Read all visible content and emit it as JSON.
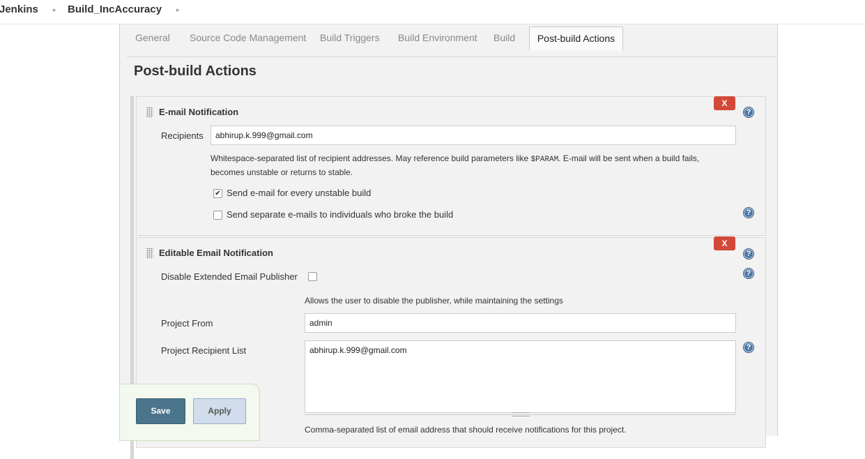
{
  "breadcrumb": {
    "items": [
      "Jenkins",
      "Build_IncAccuracy"
    ],
    "separator": "▸"
  },
  "tabs": [
    {
      "label": "General",
      "active": false
    },
    {
      "label": "Source Code Management",
      "active": false
    },
    {
      "label": "Build Triggers",
      "active": false
    },
    {
      "label": "Build Environment",
      "active": false
    },
    {
      "label": "Build",
      "active": false
    },
    {
      "label": "Post-build Actions",
      "active": true
    }
  ],
  "section_title": "Post-build Actions",
  "email_notification": {
    "title": "E-mail Notification",
    "delete_label": "X",
    "recipients_label": "Recipients",
    "recipients_value": "abhirup.k.999@gmail.com",
    "description_part1": "Whitespace-separated list of recipient addresses. May reference build parameters like ",
    "description_code": "$PARAM",
    "description_part2": ". E-mail will be sent when a build fails, becomes unstable or returns to stable.",
    "checkbox_unstable_label": "Send e-mail for every unstable build",
    "checkbox_unstable_checked": true,
    "checkbox_individuals_label": "Send separate e-mails to individuals who broke the build",
    "checkbox_individuals_checked": false
  },
  "editable_email": {
    "title": "Editable Email Notification",
    "delete_label": "X",
    "disable_label": "Disable Extended Email Publisher",
    "disable_checked": false,
    "disable_description": "Allows the user to disable the publisher, while maintaining the settings",
    "project_from_label": "Project From",
    "project_from_value": "admin",
    "recipient_list_label": "Project Recipient List",
    "recipient_list_value": "abhirup.k.999@gmail.com",
    "recipient_list_description": "Comma-separated list of email address that should receive notifications for this project."
  },
  "buttons": {
    "save": "Save",
    "apply": "Apply"
  },
  "icons": {
    "help": "help-icon",
    "delete": "close-icon",
    "drag": "drag-handle-icon"
  },
  "colors": {
    "delete_button": "#d24939",
    "help_icon": "#4d77a6",
    "save_button": "#4b758b",
    "apply_button": "#d1ddec"
  }
}
